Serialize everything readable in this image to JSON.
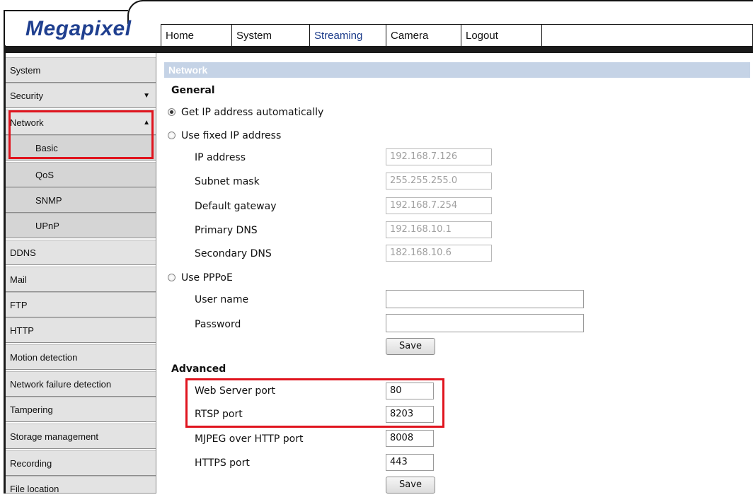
{
  "brand": {
    "logo_text": "Megapixel"
  },
  "menu": {
    "items": [
      {
        "label": "Home"
      },
      {
        "label": "System"
      },
      {
        "label": "Streaming"
      },
      {
        "label": "Camera"
      },
      {
        "label": "Logout"
      }
    ]
  },
  "sidebar": {
    "system": "System",
    "security": "Security",
    "network": "Network",
    "basic": "Basic",
    "qos": "QoS",
    "snmp": "SNMP",
    "upnp": "UPnP",
    "ddns": "DDNS",
    "mail": "Mail",
    "ftp": "FTP",
    "http": "HTTP",
    "motion": "Motion detection",
    "netfail": "Network failure detection",
    "tampering": "Tampering",
    "storage": "Storage management",
    "recording": "Recording",
    "filelocation": "File location",
    "arrow_down": "▼",
    "arrow_up": "▲"
  },
  "page": {
    "title": "Network",
    "general": "General",
    "auto_ip": "Get IP address automatically",
    "fixed_ip": "Use fixed IP address",
    "ip_label": "IP address",
    "ip_value": "192.168.7.126",
    "subnet_label": "Subnet mask",
    "subnet_value": "255.255.255.0",
    "gateway_label": "Default gateway",
    "gateway_value": "192.168.7.254",
    "dns1_label": "Primary DNS",
    "dns1_value": "192.168.10.1",
    "dns2_label": "Secondary DNS",
    "dns2_value": "182.168.10.6",
    "pppoe": "Use PPPoE",
    "user_label": "User name",
    "user_value": "",
    "pass_label": "Password",
    "pass_value": "",
    "save1": "Save",
    "advanced": "Advanced",
    "web_port_label": "Web Server port",
    "web_port_value": "80",
    "rtsp_label": "RTSP port",
    "rtsp_value": "8203",
    "mjpeg_label": "MJPEG over HTTP port",
    "mjpeg_value": "8008",
    "https_label": "HTTPS port",
    "https_value": "443",
    "save2": "Save"
  },
  "colors": {
    "highlight": "#e0141e",
    "section_header": "#c5d3e6",
    "logo": "#1f3f8f"
  }
}
